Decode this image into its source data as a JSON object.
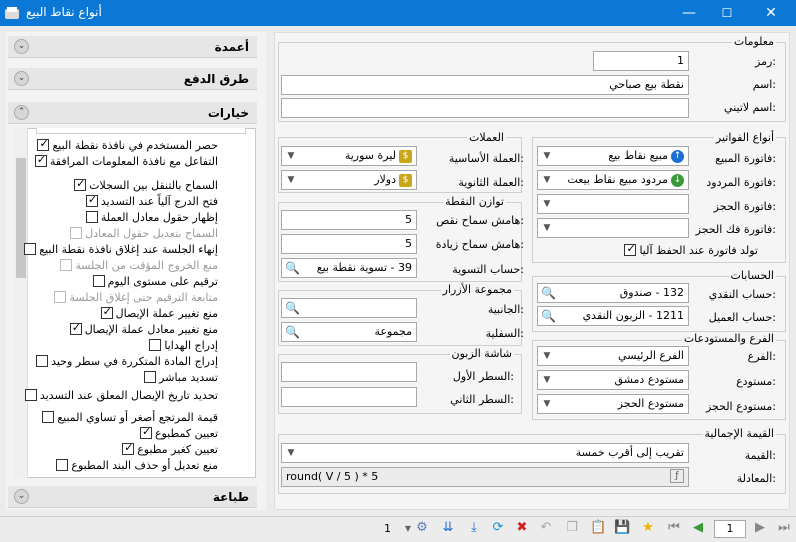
{
  "window": {
    "title": "أنواع نقاط البيع",
    "controls": {
      "close": "✕",
      "maximize": "☐",
      "minimize": "—"
    }
  },
  "sidebar": {
    "sections": {
      "columns": "أعمدة",
      "payment_methods": "طرق الدفع",
      "options": "خيارات",
      "printing": "طباعة"
    },
    "options": [
      {
        "label": "حصر المستخدم في نافذة نقطة البيع",
        "checked": true,
        "enabled": true
      },
      {
        "label": "التفاعل مع نافذة المعلومات المرافقة",
        "checked": true,
        "enabled": true
      },
      {
        "label": "السماح بالتنقل بين السجلات",
        "checked": true,
        "enabled": true
      },
      {
        "label": "فتح الدرج آلياً عند التسديد",
        "checked": true,
        "enabled": true
      },
      {
        "label": "إظهار حقول معادل العملة",
        "checked": false,
        "enabled": true
      },
      {
        "label": "السماح بتعديل حقول المعادل",
        "checked": false,
        "enabled": false
      },
      {
        "label": "إنهاء الجلسة عند إغلاق نافذة نقطة البيع",
        "checked": false,
        "enabled": true
      },
      {
        "label": "منع الخروج المؤقت من الجلسة",
        "checked": false,
        "enabled": false
      },
      {
        "label": "ترقيم على مستوى اليوم",
        "checked": false,
        "enabled": true
      },
      {
        "label": "متابعة الترقيم حتى إغلاق الجلسة",
        "checked": false,
        "enabled": false
      },
      {
        "label": "منع تغيير عملة الإيصال",
        "checked": true,
        "enabled": true
      },
      {
        "label": "منع تغيير معادل عملة الإيصال",
        "checked": true,
        "enabled": true
      },
      {
        "label": "إدراج الهدايا",
        "checked": false,
        "enabled": true
      },
      {
        "label": "إدراج المادة المتكررة في سطر وحيد",
        "checked": false,
        "enabled": true
      },
      {
        "label": "تسديد مباشر",
        "checked": false,
        "enabled": true
      },
      {
        "label": "تحديد تاريخ الإيصال المعلق عند التسديد",
        "checked": false,
        "enabled": true
      },
      {
        "label": "قيمة المرتجع أصغر أو تساوي المبيع",
        "checked": false,
        "enabled": true
      },
      {
        "label": "تعيين كمطبوع",
        "checked": true,
        "enabled": true
      },
      {
        "label": "تعيين كغير مطبوع",
        "checked": true,
        "enabled": true
      },
      {
        "label": "منع تعديل أو حذف البند المطبوع",
        "checked": false,
        "enabled": true
      }
    ]
  },
  "info": {
    "group_title": "معلومات",
    "code_label": "رمز:",
    "code_value": "1",
    "name_label": "اسم:",
    "name_value": "نقطة بيع صباحي",
    "latin_label": "اسم لاتيني:",
    "latin_value": ""
  },
  "invoices": {
    "group_title": "أنواع الفواتير",
    "sale_label": "فاتورة المبيع:",
    "sale_value": "مبيع نقاط بيع",
    "return_label": "فاتورة المردود:",
    "return_value": "مردود مبيع نقاط بيعت",
    "reserve_label": "فاتورة الحجز:",
    "reserve_value": "",
    "unreserve_label": "فاتورة فك الحجز:",
    "unreserve_value": "",
    "autosave_label": "تولد فاتورة عند الحفظ آليا",
    "autosave_checked": true
  },
  "currencies": {
    "group_title": "العملات",
    "base_label": "العملة الأساسية:",
    "base_value": "ليرة سورية",
    "secondary_label": "العملة الثانوية:",
    "secondary_value": "دولار"
  },
  "balance": {
    "group_title": "توازن النقطة",
    "deficit_label": "هامش سماح نقص:",
    "deficit_value": "5",
    "surplus_label": "هامش سماح زيادة:",
    "surplus_value": "5",
    "settle_label": "حساب التسوية:",
    "settle_value": "39 - تسوية نقطة بيع"
  },
  "buttons_group": {
    "group_title": "مجموعة الأزرار",
    "side_label": "الجانبية:",
    "side_value": "",
    "bottom_label": "السفلية:",
    "bottom_value": "مجموعة"
  },
  "customer_screen": {
    "group_title": "شاشة الزبون",
    "line1_label": "السطر الأول:",
    "line1_value": "",
    "line2_label": "السطر الثاني:",
    "line2_value": ""
  },
  "accounts": {
    "group_title": "الحسابات",
    "cash_label": "حساب النقدي:",
    "cash_value": "132 - صندوق",
    "customer_label": "حساب العميل:",
    "customer_value": "1211 - الزبون النقدي"
  },
  "branch": {
    "group_title": "الفرع والمستودعات",
    "branch_label": "الفرع:",
    "branch_value": "الفرع الرئيسي",
    "store_label": "مستودع:",
    "store_value": "مستودع دمشق",
    "reserve_store_label": "مستودع الحجز:",
    "reserve_store_value": "مستودع الحجز"
  },
  "total": {
    "group_title": "القيمة الإجمالية",
    "value_label": "القيمة:",
    "value_value": "تقريب إلى أقرب خمسة",
    "formula_label": "المعادلة:",
    "formula_value": "round( V / 5 ) * 5"
  },
  "toolbar": {
    "page_current": "1",
    "page_total": "1"
  },
  "colors": {
    "titlebar": "#0a78d4",
    "accent_green": "#3a9a3a",
    "accent_blue": "#1f6fd0"
  }
}
